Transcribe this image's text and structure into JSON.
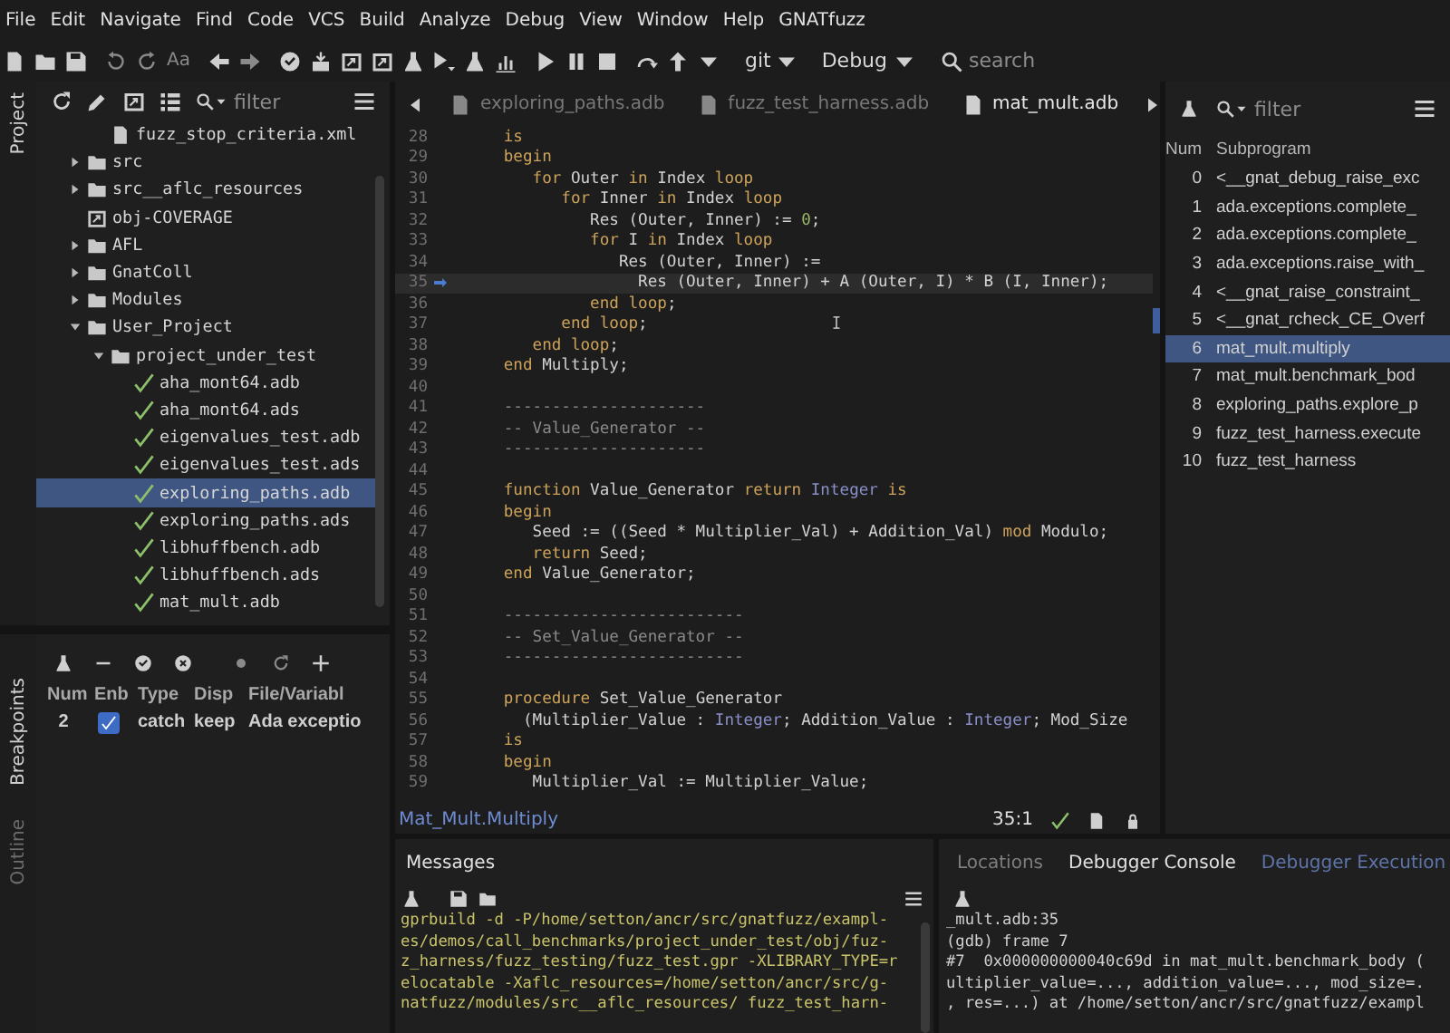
{
  "menu": [
    "File",
    "Edit",
    "Navigate",
    "Find",
    "Code",
    "VCS",
    "Build",
    "Analyze",
    "Debug",
    "View",
    "Window",
    "Help",
    "GNATfuzz"
  ],
  "toolbar": {
    "font_button": "Aa",
    "vcs_dropdown": "git",
    "build_mode_dropdown": "Debug",
    "search": {
      "placeholder": "search"
    }
  },
  "side_tabs_top": [
    {
      "label": "Project",
      "selected": true
    }
  ],
  "side_tabs_bottom": [
    {
      "label": "Breakpoints",
      "selected": true
    },
    {
      "label": "Outline",
      "selected": false
    }
  ],
  "project": {
    "filter": {
      "placeholder": "filter"
    },
    "tree": [
      {
        "label": "fuzz_stop_criteria.xml",
        "kind": "file",
        "selected": false
      },
      {
        "label": "src",
        "kind": "folder",
        "expanded": false,
        "selected": false
      },
      {
        "label": "src__aflc_resources",
        "kind": "folder",
        "expanded": false,
        "selected": false
      },
      {
        "label": "obj-COVERAGE",
        "kind": "object-dir",
        "selected": false
      },
      {
        "label": "AFL",
        "kind": "folder",
        "expanded": false,
        "selected": false
      },
      {
        "label": "GnatColl",
        "kind": "folder",
        "expanded": false,
        "selected": false
      },
      {
        "label": "Modules",
        "kind": "folder",
        "expanded": false,
        "selected": false
      },
      {
        "label": "User_Project",
        "kind": "folder",
        "expanded": true,
        "selected": false,
        "children": [
          {
            "label": "project_under_test",
            "kind": "folder",
            "expanded": true,
            "selected": false,
            "children": [
              {
                "label": "aha_mont64.adb",
                "kind": "source",
                "selected": false
              },
              {
                "label": "aha_mont64.ads",
                "kind": "source",
                "selected": false
              },
              {
                "label": "eigenvalues_test.adb",
                "kind": "source",
                "selected": false
              },
              {
                "label": "eigenvalues_test.ads",
                "kind": "source",
                "selected": false
              },
              {
                "label": "exploring_paths.adb",
                "kind": "source",
                "selected": true
              },
              {
                "label": "exploring_paths.ads",
                "kind": "source",
                "selected": false
              },
              {
                "label": "libhuffbench.adb",
                "kind": "source",
                "selected": false
              },
              {
                "label": "libhuffbench.ads",
                "kind": "source",
                "selected": false
              },
              {
                "label": "mat_mult.adb",
                "kind": "source",
                "selected": false
              }
            ]
          }
        ]
      }
    ]
  },
  "breakpoints": {
    "columns": [
      "Num",
      "Enb",
      "Type",
      "Disp",
      "File/Variabl"
    ],
    "rows": [
      {
        "num": "2",
        "enabled": true,
        "type": "catch",
        "disp": "keep",
        "file": "Ada exceptio"
      }
    ]
  },
  "editor": {
    "tabs": [
      {
        "label": "exploring_paths.adb",
        "selected": false
      },
      {
        "label": "fuzz_test_harness.adb",
        "selected": false
      },
      {
        "label": "mat_mult.adb",
        "selected": true
      }
    ],
    "lines": [
      {
        "number": "28",
        "current": false,
        "tokens": [
          {
            "kind": "keyword",
            "text": "   is"
          }
        ]
      },
      {
        "number": "29",
        "current": false,
        "tokens": [
          {
            "kind": "keyword",
            "text": "   begin"
          }
        ]
      },
      {
        "number": "30",
        "current": false,
        "tokens": [
          {
            "kind": "keyword",
            "text": "      for"
          },
          {
            "kind": "plain",
            "text": " Outer "
          },
          {
            "kind": "keyword",
            "text": "in"
          },
          {
            "kind": "plain",
            "text": " Index "
          },
          {
            "kind": "keyword",
            "text": "loop"
          }
        ]
      },
      {
        "number": "31",
        "current": false,
        "tokens": [
          {
            "kind": "keyword",
            "text": "         for"
          },
          {
            "kind": "plain",
            "text": " Inner "
          },
          {
            "kind": "keyword",
            "text": "in"
          },
          {
            "kind": "plain",
            "text": " Index "
          },
          {
            "kind": "keyword",
            "text": "loop"
          }
        ]
      },
      {
        "number": "32",
        "current": false,
        "tokens": [
          {
            "kind": "plain",
            "text": "            Res (Outer, Inner) := "
          },
          {
            "kind": "number",
            "text": "0"
          },
          {
            "kind": "plain",
            "text": ";"
          }
        ]
      },
      {
        "number": "33",
        "current": false,
        "tokens": [
          {
            "kind": "keyword",
            "text": "            for"
          },
          {
            "kind": "plain",
            "text": " I "
          },
          {
            "kind": "keyword",
            "text": "in"
          },
          {
            "kind": "plain",
            "text": " Index "
          },
          {
            "kind": "keyword",
            "text": "loop"
          }
        ]
      },
      {
        "number": "34",
        "current": false,
        "tokens": [
          {
            "kind": "plain",
            "text": "               Res (Outer, Inner) :="
          }
        ]
      },
      {
        "number": "35",
        "current": true,
        "tokens": [
          {
            "kind": "plain",
            "text": "                 Res (Outer, Inner) + A (Outer, I) * B (I, Inner);"
          }
        ]
      },
      {
        "number": "36",
        "current": false,
        "tokens": [
          {
            "kind": "keyword",
            "text": "            end loop"
          },
          {
            "kind": "plain",
            "text": ";"
          }
        ]
      },
      {
        "number": "37",
        "current": false,
        "tokens": [
          {
            "kind": "keyword",
            "text": "         end loop"
          },
          {
            "kind": "plain",
            "text": ";"
          }
        ]
      },
      {
        "number": "38",
        "current": false,
        "tokens": [
          {
            "kind": "keyword",
            "text": "      end loop"
          },
          {
            "kind": "plain",
            "text": ";"
          }
        ]
      },
      {
        "number": "39",
        "current": false,
        "tokens": [
          {
            "kind": "keyword",
            "text": "   end"
          },
          {
            "kind": "plain",
            "text": " Multiply;"
          }
        ]
      },
      {
        "number": "40"
      },
      {
        "number": "41",
        "current": false,
        "tokens": [
          {
            "kind": "comment",
            "text": "   ---------------------"
          }
        ]
      },
      {
        "number": "42",
        "current": false,
        "tokens": [
          {
            "kind": "comment",
            "text": "   -- Value_Generator --"
          }
        ]
      },
      {
        "number": "43",
        "current": false,
        "tokens": [
          {
            "kind": "comment",
            "text": "   ---------------------"
          }
        ]
      },
      {
        "number": "44"
      },
      {
        "number": "45",
        "current": false,
        "tokens": [
          {
            "kind": "keyword",
            "text": "   function"
          },
          {
            "kind": "plain",
            "text": " Value_Generator "
          },
          {
            "kind": "keyword",
            "text": "return"
          },
          {
            "kind": "type",
            "text": " Integer"
          },
          {
            "kind": "keyword",
            "text": " is"
          }
        ]
      },
      {
        "number": "46",
        "current": false,
        "tokens": [
          {
            "kind": "keyword",
            "text": "   begin"
          }
        ]
      },
      {
        "number": "47",
        "current": false,
        "tokens": [
          {
            "kind": "plain",
            "text": "      Seed := ((Seed * Multiplier_Val) + Addition_Val) "
          },
          {
            "kind": "keyword",
            "text": "mod"
          },
          {
            "kind": "plain",
            "text": " Modulo;"
          }
        ]
      },
      {
        "number": "48",
        "current": false,
        "tokens": [
          {
            "kind": "keyword",
            "text": "      return"
          },
          {
            "kind": "plain",
            "text": " Seed;"
          }
        ]
      },
      {
        "number": "49",
        "current": false,
        "tokens": [
          {
            "kind": "keyword",
            "text": "   end"
          },
          {
            "kind": "plain",
            "text": " Value_Generator;"
          }
        ]
      },
      {
        "number": "50"
      },
      {
        "number": "51",
        "current": false,
        "tokens": [
          {
            "kind": "comment",
            "text": "   -------------------------"
          }
        ]
      },
      {
        "number": "52",
        "current": false,
        "tokens": [
          {
            "kind": "comment",
            "text": "   -- Set_Value_Generator --"
          }
        ]
      },
      {
        "number": "53",
        "current": false,
        "tokens": [
          {
            "kind": "comment",
            "text": "   -------------------------"
          }
        ]
      },
      {
        "number": "54"
      },
      {
        "number": "55",
        "current": false,
        "tokens": [
          {
            "kind": "keyword",
            "text": "   procedure"
          },
          {
            "kind": "plain",
            "text": " Set_Value_Generator"
          }
        ]
      },
      {
        "number": "56",
        "current": false,
        "tokens": [
          {
            "kind": "plain",
            "text": "     (Multiplier_Value : "
          },
          {
            "kind": "type",
            "text": "Integer"
          },
          {
            "kind": "plain",
            "text": "; Addition_Value : "
          },
          {
            "kind": "type",
            "text": "Integer"
          },
          {
            "kind": "plain",
            "text": "; Mod_Size"
          }
        ]
      },
      {
        "number": "57",
        "current": false,
        "tokens": [
          {
            "kind": "keyword",
            "text": "   is"
          }
        ]
      },
      {
        "number": "58",
        "current": false,
        "tokens": [
          {
            "kind": "keyword",
            "text": "   begin"
          }
        ]
      },
      {
        "number": "59",
        "current": false,
        "tokens": [
          {
            "kind": "plain",
            "text": "      Multiplier_Val := Multiplier_Value;"
          }
        ]
      }
    ],
    "status": {
      "location": "Mat_Mult.Multiply",
      "cursor": "35:1"
    }
  },
  "call_stack": {
    "filter": {
      "placeholder": "filter"
    },
    "columns": [
      "Num",
      "Subprogram"
    ],
    "rows": [
      {
        "num": "0",
        "subprogram": "<__gnat_debug_raise_exc",
        "selected": false
      },
      {
        "num": "1",
        "subprogram": "ada.exceptions.complete_",
        "selected": false
      },
      {
        "num": "2",
        "subprogram": "ada.exceptions.complete_",
        "selected": false
      },
      {
        "num": "3",
        "subprogram": "ada.exceptions.raise_with_",
        "selected": false
      },
      {
        "num": "4",
        "subprogram": "<__gnat_raise_constraint_",
        "selected": false
      },
      {
        "num": "5",
        "subprogram": "<__gnat_rcheck_CE_Overf",
        "selected": false
      },
      {
        "num": "6",
        "subprogram": "mat_mult.multiply",
        "selected": true
      },
      {
        "num": "7",
        "subprogram": "mat_mult.benchmark_bod",
        "selected": false
      },
      {
        "num": "8",
        "subprogram": "exploring_paths.explore_p",
        "selected": false
      },
      {
        "num": "9",
        "subprogram": "fuzz_test_harness.execute",
        "selected": false
      },
      {
        "num": "10",
        "subprogram": "fuzz_test_harness",
        "selected": false
      }
    ]
  },
  "messages": {
    "title": "Messages",
    "lines": [
      "gprbuild -d -P/home/setton/ancr/src/gnatfuzz/exampl-",
      "es/demos/call_benchmarks/project_under_test/obj/fuz-",
      "z_harness/fuzz_testing/fuzz_test.gpr -XLIBRARY_TYPE=r",
      "elocatable -Xaflc_resources=/home/setton/ancr/src/g-",
      "natfuzz/modules/src__aflc_resources/ fuzz_test_harn-"
    ]
  },
  "debugger": {
    "tabs": [
      {
        "label": "Locations",
        "selected": false,
        "highlighted": false
      },
      {
        "label": "Debugger Console",
        "selected": true,
        "highlighted": false
      },
      {
        "label": "Debugger Execution",
        "selected": false,
        "highlighted": true
      }
    ],
    "lines": [
      "_mult.adb:35",
      "(gdb) frame 7",
      "#7  0x000000000040c69d in mat_mult.benchmark_body (",
      "ultiplier_value=..., addition_value=..., mod_size=.",
      ", res=...) at /home/setton/ancr/src/gnatfuzz/exampl"
    ]
  }
}
